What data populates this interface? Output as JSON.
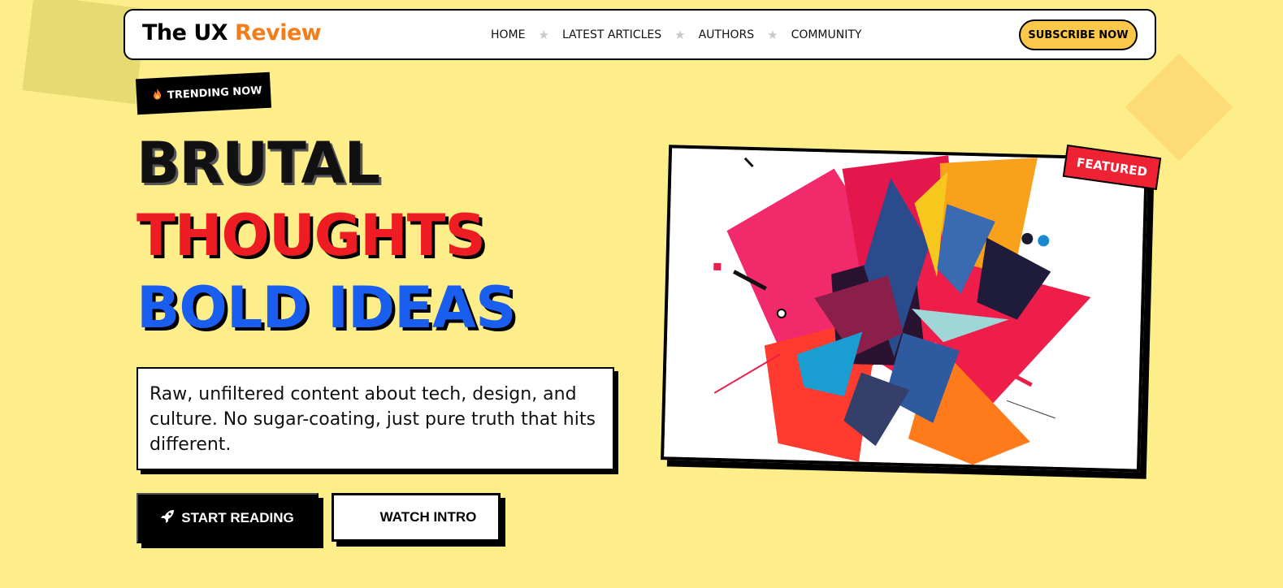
{
  "brand": {
    "name_part1": "The UX",
    "name_part2": "Review"
  },
  "nav": {
    "items": [
      "HOME",
      "LATEST ARTICLES",
      "AUTHORS",
      "COMMUNITY"
    ],
    "separator": "★",
    "subscribe_label": "SUBSCRIBE NOW"
  },
  "hero": {
    "trending_label": "TRENDING NOW",
    "headline_line1": "BRUTAL",
    "headline_line2": "THOUGHTS",
    "headline_line3": "BOLD IDEAS",
    "description": "Raw, unfiltered content about tech, design, and culture. No sugar-coating, just pure truth that hits different.",
    "primary_button": "START READING",
    "secondary_button": "WATCH INTRO"
  },
  "featured": {
    "tag": "FEATURED"
  },
  "colors": {
    "background": "#fdee8a",
    "accent_orange": "#f47d1b",
    "headline_red": "#ee1d23",
    "headline_blue": "#1a5ef0",
    "subscribe_yellow": "#fcc84a",
    "featured_red": "#ee2233"
  },
  "icons": {
    "trending": "flame-icon",
    "start": "rocket-icon",
    "nav_separator": "star-icon"
  }
}
